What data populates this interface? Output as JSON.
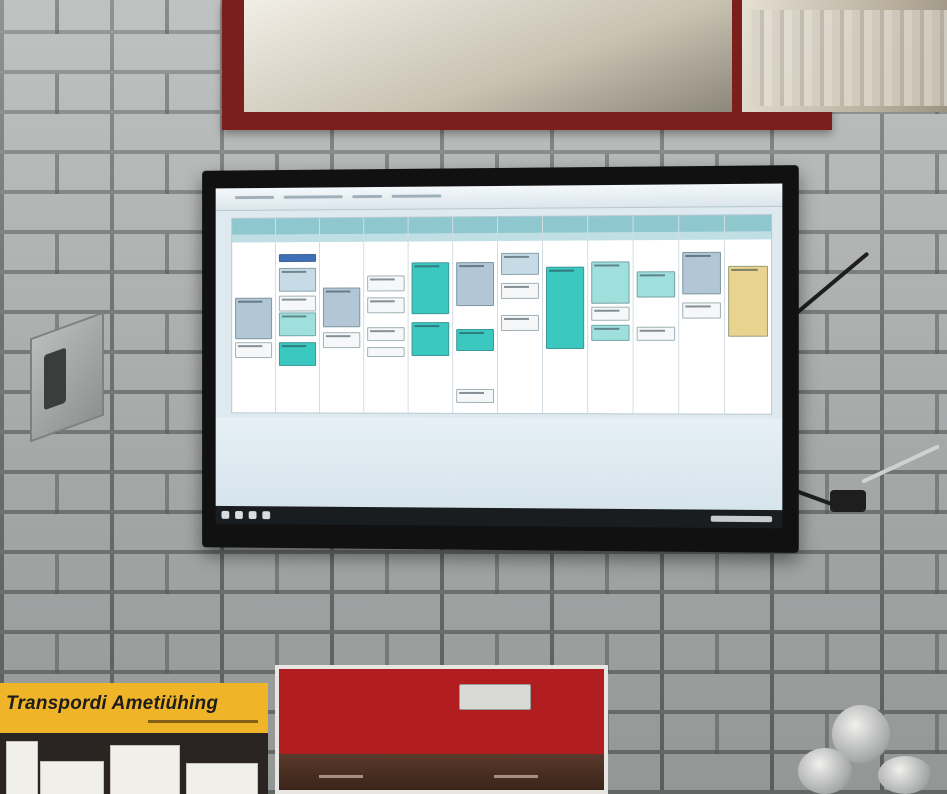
{
  "sign": {
    "title": "Transpordi Ametiühing"
  },
  "calendar": {
    "columns": 12
  },
  "colors": {
    "sign_yellow": "#f0b428",
    "board_red": "#b21d1f",
    "window_frame": "#7b1f1c",
    "event_teal": "#3bc8c0",
    "event_yellow": "#e9d48f",
    "header_teal": "#8fc7cf"
  }
}
